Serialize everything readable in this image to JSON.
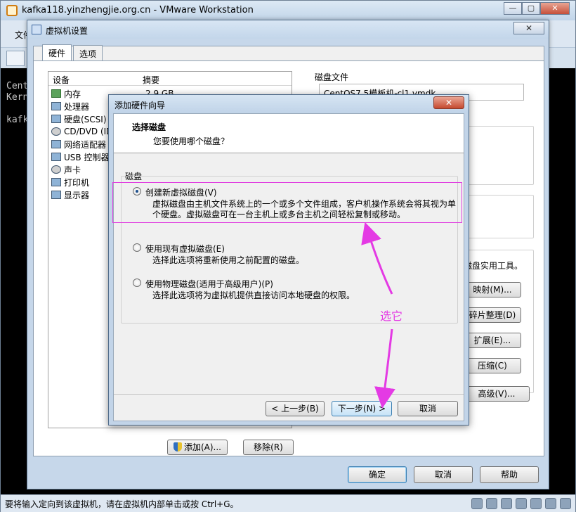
{
  "vmware": {
    "title": "kafka118.yinzhengjie.org.cn - VMware Workstation",
    "menu_first": "文件",
    "window_buttons": [
      "—",
      "▢",
      "✕"
    ],
    "console_lines": [
      "Cent",
      "Kern",
      "kafk"
    ],
    "status_text": "要将输入定向到该虚拟机，请在虚拟机内部单击或按 Ctrl+G。"
  },
  "settings": {
    "title": "虚拟机设置",
    "close": "✕",
    "tabs": [
      "硬件",
      "选项"
    ],
    "device_header": {
      "device": "设备",
      "summary": "摘要"
    },
    "devices": [
      {
        "name": "内存",
        "icon": "memory-icon"
      },
      {
        "name": "处理器",
        "icon": "cpu-icon"
      },
      {
        "name": "硬盘(SCSI)",
        "icon": "hard-disk-icon"
      },
      {
        "name": "CD/DVD (ID",
        "icon": "cd-dvd-icon"
      },
      {
        "name": "网络适配器",
        "icon": "network-icon"
      },
      {
        "name": "USB 控制器",
        "icon": "usb-icon"
      },
      {
        "name": "声卡",
        "icon": "sound-icon"
      },
      {
        "name": "打印机",
        "icon": "printer-icon"
      },
      {
        "name": "显示器",
        "icon": "monitor-icon"
      }
    ],
    "memory_summary": "2.9 GB",
    "add_button": "添加(A)...",
    "remove_button": "移除(R)",
    "disk_file_label": "磁盘文件",
    "disk_file_value": "CentOS7.5模板机-cl1.vmdk",
    "utility_text": "磁盘实用工具。",
    "map_button": "映射(M)...",
    "defrag_button": "碎片整理(D)",
    "expand_button": "扩展(E)...",
    "compact_button": "压缩(C)",
    "advanced_button": "高级(V)...",
    "ok_button": "确定",
    "cancel_button": "取消",
    "help_button": "帮助"
  },
  "wizard": {
    "title": "添加硬件向导",
    "close": "✕",
    "heading": "选择磁盘",
    "subheading": "您要使用哪个磁盘？",
    "group_label": "磁盘",
    "options": [
      {
        "label": "创建新虚拟磁盘(V)",
        "desc": "虚拟磁盘由主机文件系统上的一个或多个文件组成，客户机操作系统会将其视为单个硬盘。虚拟磁盘可在一台主机上或多台主机之间轻松复制或移动。",
        "checked": true
      },
      {
        "label": "使用现有虚拟磁盘(E)",
        "desc": "选择此选项将重新使用之前配置的磁盘。",
        "checked": false
      },
      {
        "label": "使用物理磁盘(适用于高级用户)(P)",
        "desc": "选择此选项将为虚拟机提供直接访问本地硬盘的权限。",
        "checked": false
      }
    ],
    "back_button": "< 上一步(B)",
    "next_button": "下一步(N) >",
    "cancel_button": "取消"
  },
  "annotation": {
    "text": "选它",
    "color": "#e43ae4"
  }
}
